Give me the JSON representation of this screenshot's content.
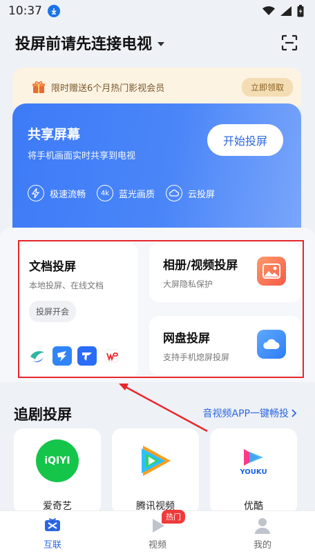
{
  "status": {
    "time": "10:37"
  },
  "header": {
    "title": "投屏前请先连接电视"
  },
  "promo": {
    "text": "限时赠送6个月热门影视会员",
    "button": "立即领取"
  },
  "share": {
    "title": "共享屏幕",
    "subtitle": "将手机画面实时共享到电视",
    "button": "开始投屏",
    "features": [
      {
        "icon": "lightning-icon",
        "label": "极速流畅"
      },
      {
        "icon": "4k-icon",
        "icon_text": "4k",
        "label": "蓝光画质"
      },
      {
        "icon": "cloud-icon",
        "label": "云投屏"
      }
    ]
  },
  "doc_card": {
    "title": "文档投屏",
    "subtitle": "本地投屏、在线文档",
    "tag": "投屏开会"
  },
  "album_card": {
    "title": "相册/视频投屏",
    "subtitle": "大屏隐私保护"
  },
  "cloud_card": {
    "title": "网盘投屏",
    "subtitle": "支持手机熄屏投屏"
  },
  "drama": {
    "title": "追剧投屏",
    "link": "音视频APP一键畅投",
    "apps": [
      {
        "name": "爱奇艺",
        "logo_text": "iQIYI"
      },
      {
        "name": "腾讯视频"
      },
      {
        "name": "优酷",
        "logo_text": "YOUKU"
      }
    ]
  },
  "nav": {
    "items": [
      {
        "label": "互联",
        "active": true
      },
      {
        "label": "视频",
        "badge": "热门"
      },
      {
        "label": "我的"
      }
    ]
  },
  "colors": {
    "accent": "#2a66e0",
    "highlight": "#e8262a"
  }
}
